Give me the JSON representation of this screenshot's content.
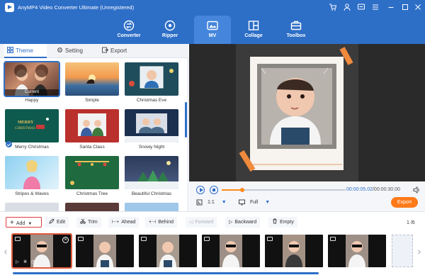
{
  "app": {
    "title": "AnyMP4 Video Converter Ultimate (Unregistered)"
  },
  "nav": {
    "tabs": [
      {
        "label": "Converter",
        "icon": "converter-icon"
      },
      {
        "label": "Ripper",
        "icon": "ripper-icon"
      },
      {
        "label": "MV",
        "icon": "mv-icon",
        "active": true
      },
      {
        "label": "Collage",
        "icon": "collage-icon"
      },
      {
        "label": "Toolbox",
        "icon": "toolbox-icon"
      }
    ]
  },
  "panel_tabs": [
    {
      "label": "Theme",
      "active": true
    },
    {
      "label": "Setting"
    },
    {
      "label": "Export"
    }
  ],
  "themes": [
    {
      "name": "Happy",
      "selected": true,
      "tag": "Current"
    },
    {
      "name": "Simple"
    },
    {
      "name": "Christmas Eve"
    },
    {
      "name": "Merry Christmas"
    },
    {
      "name": "Santa Claus"
    },
    {
      "name": "Snowy Night"
    },
    {
      "name": "Stripes & Waves"
    },
    {
      "name": "Christmas Tree"
    },
    {
      "name": "Beautiful Christmas"
    },
    {
      "name": ""
    },
    {
      "name": ""
    },
    {
      "name": ""
    }
  ],
  "player": {
    "current_time": "00:00:05.02",
    "total_time": "/00:00:30.00",
    "progress": 0.167,
    "ratio": "1:1",
    "zoom": "Full",
    "export_label": "Export"
  },
  "toolbar": {
    "add": "Add",
    "edit": "Edit",
    "trim": "Trim",
    "ahead": "Ahead",
    "behind": "Behind",
    "forward": "Forward",
    "backward": "Backward",
    "empty": "Empty",
    "page": "1 /6"
  },
  "timeline": {
    "clip_count": 6,
    "scroll_fraction": 0.75
  },
  "colors": {
    "brand": "#2d6ec7",
    "accent": "#ff7a1a",
    "selected_outline": "#e23c3c"
  }
}
